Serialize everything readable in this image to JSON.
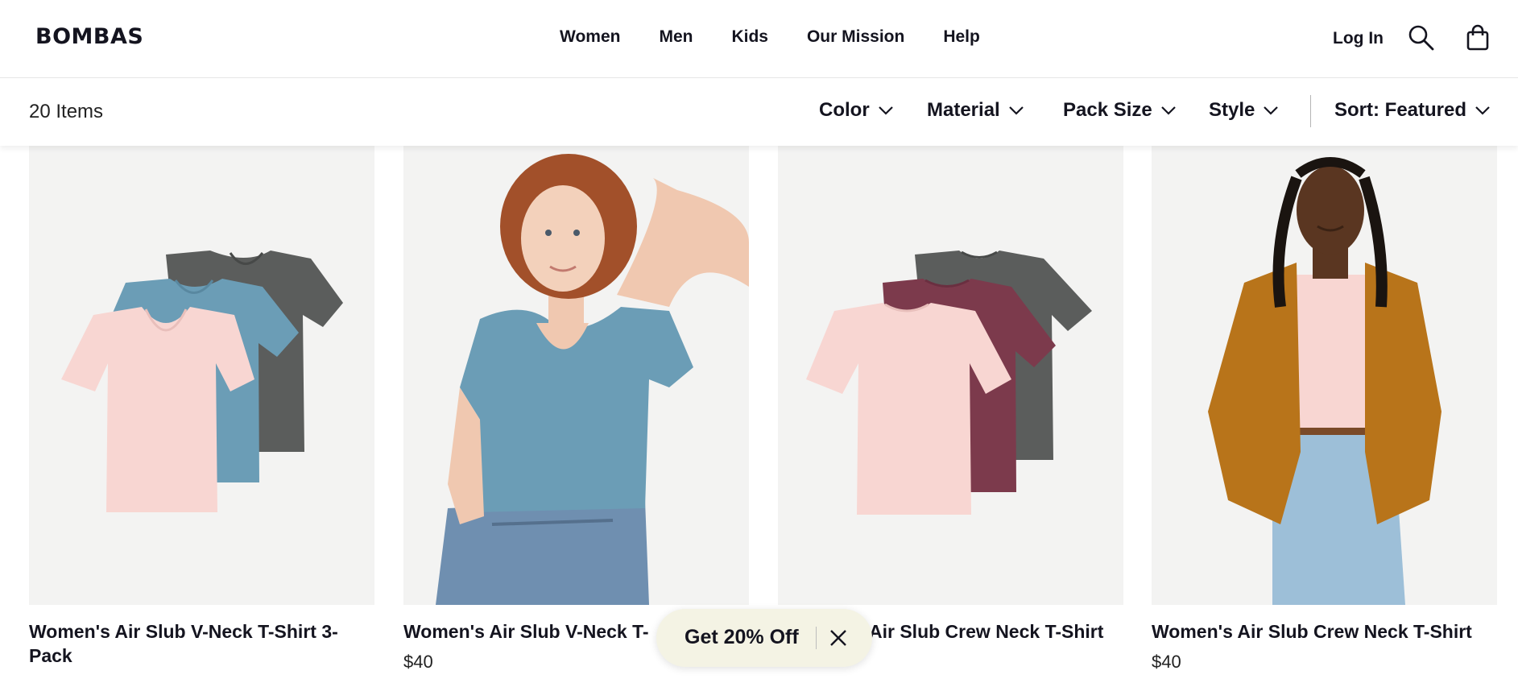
{
  "header": {
    "logo": "BOMBAS",
    "nav": [
      "Women",
      "Men",
      "Kids",
      "Our Mission",
      "Help"
    ],
    "login": "Log In",
    "icons": [
      "search-icon",
      "shopping-bag-icon"
    ]
  },
  "filters": {
    "count": "20 Items",
    "items": [
      "Color",
      "Material",
      "Pack Size",
      "Style"
    ],
    "sort": "Sort: Featured"
  },
  "products": [
    {
      "name": "Women's Air Slub V-Neck T-Shirt 3-Pack",
      "price": "",
      "image": "folded t-shirts: pink, blue, gray"
    },
    {
      "name": "Women's Air Slub V-Neck T-",
      "price": "$40",
      "image": "model in blue v-neck t-shirt"
    },
    {
      "name": "Air Slub Crew Neck T-Shirt",
      "price": "",
      "image": "folded t-shirts: pink, burgundy, gray"
    },
    {
      "name": "Women's Air Slub Crew Neck T-Shirt",
      "price": "$40",
      "image": "model in pink tee and mustard shirt jacket"
    }
  ],
  "promo": {
    "text": "Get 20% Off"
  },
  "colors": {
    "text": "#14141f",
    "image_bg": "#f3f3f2",
    "promo_bg": "#f4f3e4",
    "pink": "#f8d6d2",
    "blue": "#6b9db6",
    "gray": "#5b5d5c",
    "burgundy": "#7c3a4c",
    "mustard": "#b8741a",
    "denim": "#9dbfd8"
  }
}
